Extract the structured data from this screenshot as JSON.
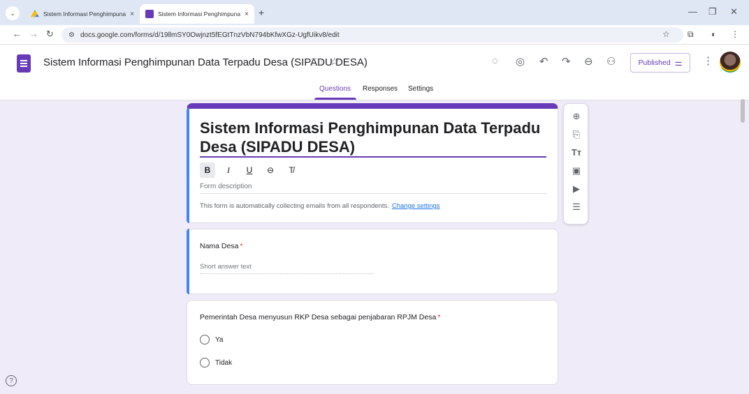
{
  "browser": {
    "tabs": [
      {
        "title": "Sistem Informasi Penghimpuna",
        "icon": "drive-icon"
      },
      {
        "title": "Sistem Informasi Penghimpuna",
        "icon": "forms-icon"
      }
    ],
    "close_glyph": "×",
    "new_tab_glyph": "+",
    "url": "docs.google.com/forms/d/19llmSY0Owjnzt5fEGtTnzVbN794bKfwXGz-UgfUikv8/edit"
  },
  "header": {
    "doc_title": "Sistem Informasi Penghimpunan Data Terpadu Desa (SIPADU DESA)",
    "publish_label": "Published",
    "tabs": [
      "Questions",
      "Responses",
      "Settings"
    ],
    "active_tab": "Questions"
  },
  "form": {
    "title": "Sistem Informasi Penghimpunan Data Terpadu Desa (SIPADU DESA)",
    "format_buttons": [
      "B",
      "I",
      "U"
    ],
    "description_placeholder": "Form description",
    "email_note": "This form is automatically collecting emails from all respondents.",
    "change_settings": "Change settings"
  },
  "questions": [
    {
      "title": "Nama Desa",
      "required_mark": "*",
      "answer_placeholder": "Short answer text"
    },
    {
      "title": "Pemerintah Desa menyusun RKP Desa sebagai penjabaran RPJM Desa",
      "required_mark": "*",
      "options": [
        "Ya",
        "Tidak"
      ]
    }
  ],
  "colors": {
    "accent": "#673ab7",
    "background": "#f0ebf8",
    "required": "#d93025",
    "link": "#1a73e8"
  }
}
